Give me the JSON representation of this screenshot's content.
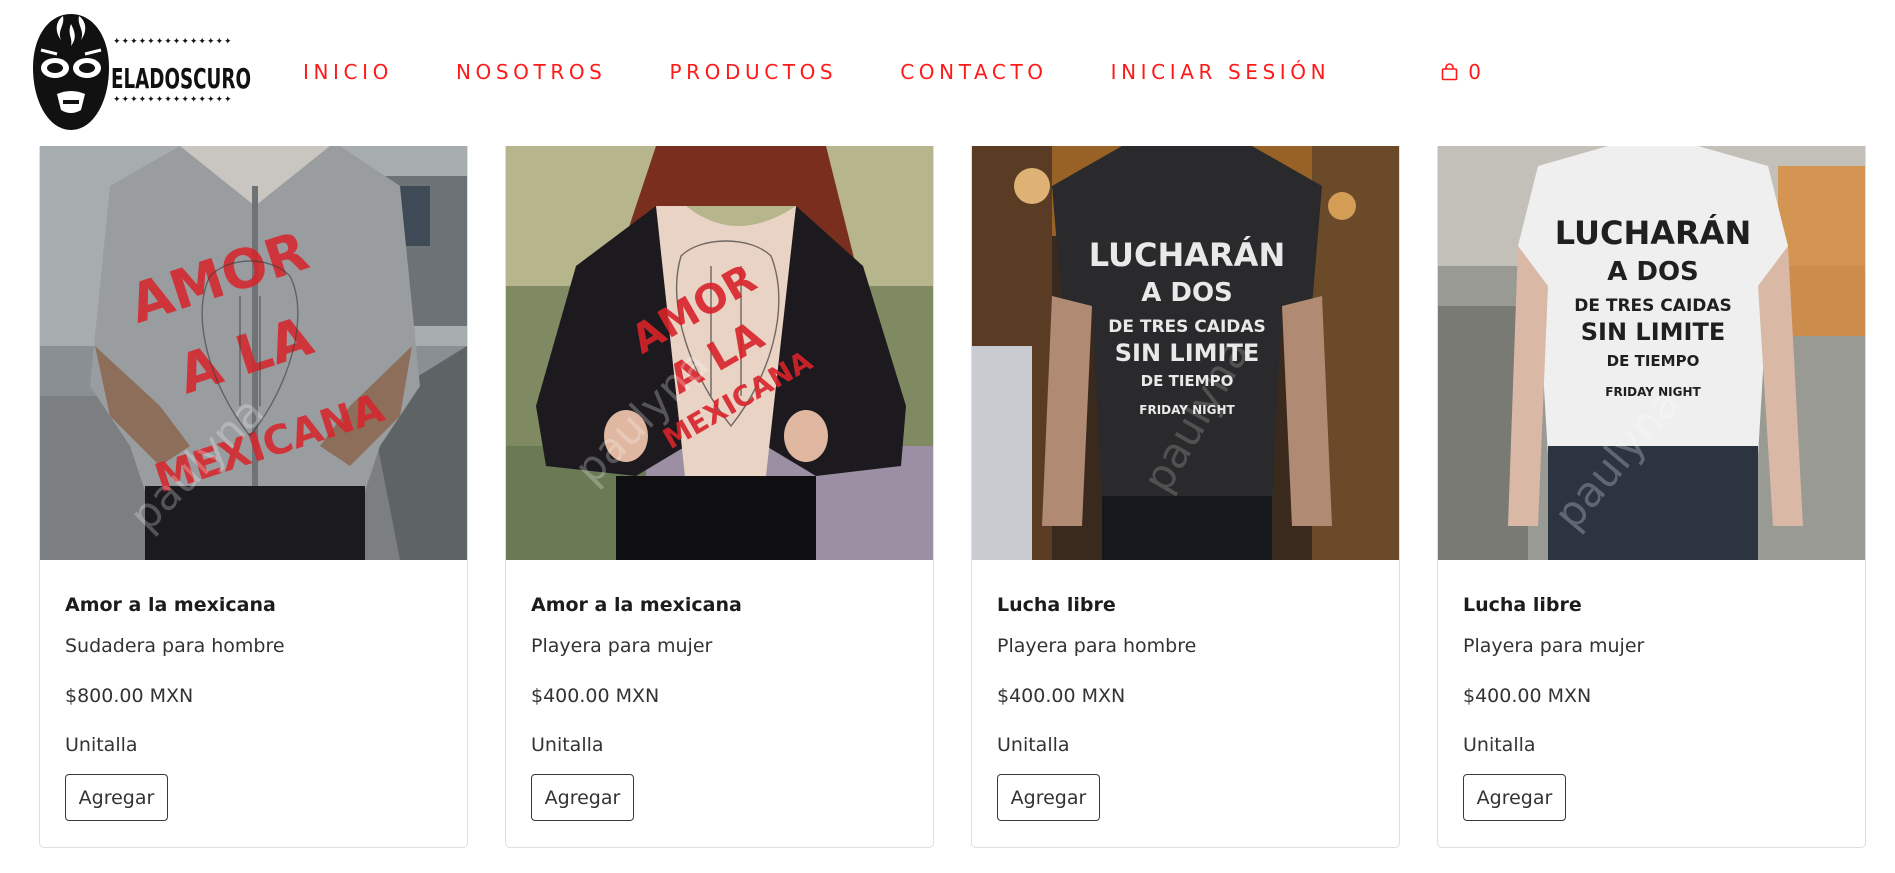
{
  "brand": {
    "logo_text": "ELADOSCURO"
  },
  "nav": {
    "items": [
      {
        "label": "INICIO"
      },
      {
        "label": "NOSOTROS"
      },
      {
        "label": "PRODUCTOS"
      },
      {
        "label": "CONTACTO"
      },
      {
        "label": "INICIAR SESIÓN"
      }
    ],
    "cart_count": "0"
  },
  "colors": {
    "accent": "#ff1a1a",
    "card_border": "#dcdfe3",
    "button_border": "#3a3a3a"
  },
  "products": [
    {
      "title": "Amor a la mexicana",
      "subtitle": "Sudadera para hombre",
      "price": "$800.00 MXN",
      "size": "Unitalla",
      "button": "Agregar",
      "print_lines": [
        "AMOR",
        "A LA",
        "MEXICANA"
      ]
    },
    {
      "title": "Amor a la mexicana",
      "subtitle": "Playera para mujer",
      "price": "$400.00 MXN",
      "size": "Unitalla",
      "button": "Agregar",
      "print_lines": [
        "AMOR",
        "A LA",
        "MEXICANA"
      ]
    },
    {
      "title": "Lucha libre",
      "subtitle": "Playera para hombre",
      "price": "$400.00 MXN",
      "size": "Unitalla",
      "button": "Agregar",
      "print_lines": [
        "LUCHARÁN",
        "A DOS",
        "DE TRES CAIDAS",
        "SIN LIMITE",
        "DE TIEMPO",
        "FRIDAY NIGHT"
      ]
    },
    {
      "title": "Lucha libre",
      "subtitle": "Playera para mujer",
      "price": "$400.00 MXN",
      "size": "Unitalla",
      "button": "Agregar",
      "print_lines": [
        "LUCHARÁN",
        "A DOS",
        "DE TRES CAIDAS",
        "SIN LIMITE",
        "DE TIEMPO",
        "FRIDAY NIGHT"
      ]
    }
  ],
  "watermark": "paulyna"
}
